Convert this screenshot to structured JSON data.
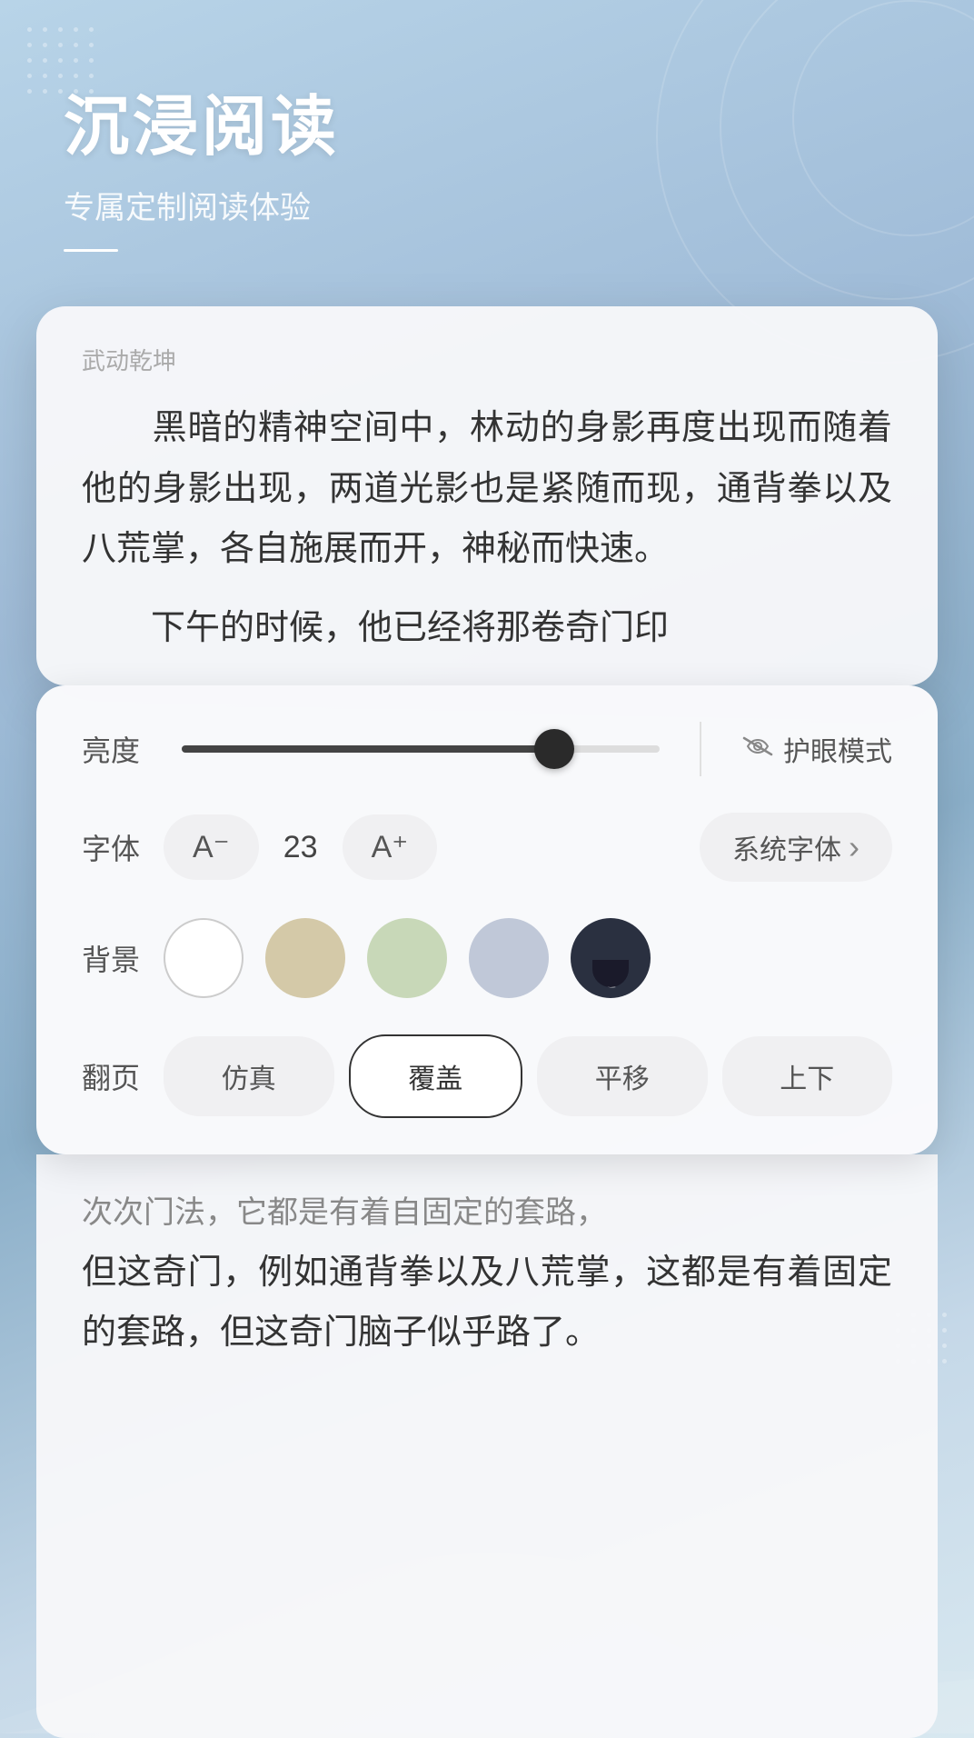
{
  "header": {
    "title": "沉浸阅读",
    "subtitle": "专属定制阅读体验"
  },
  "reading_card": {
    "book_title": "武动乾坤",
    "paragraphs": [
      "　　黑暗的精神空间中，林动的身影再度出现而随着他的身影出现，两道光影也是紧随而现，通背拳以及八荒掌，各自施展而开，神秘而快速。",
      "　　下午的时候，他已经将那卷奇门印"
    ]
  },
  "settings": {
    "brightness_label": "亮度",
    "brightness_value": 78,
    "eye_mode_label": "护眼模式",
    "font_label": "字体",
    "font_decrease_label": "A⁻",
    "font_size_value": "23",
    "font_increase_label": "A⁺",
    "font_family_label": "系统字体",
    "bg_label": "背景",
    "bg_options": [
      {
        "id": "white",
        "color": "#ffffff",
        "active": false
      },
      {
        "id": "beige",
        "color": "#d4c9a8",
        "active": false
      },
      {
        "id": "green",
        "color": "#c8d8b8",
        "active": false
      },
      {
        "id": "blue_gray",
        "color": "#c0c8d8",
        "active": false
      },
      {
        "id": "dark",
        "color": "#2a3040",
        "active": false
      }
    ],
    "pageturn_label": "翻页",
    "pageturn_options": [
      {
        "id": "simulate",
        "label": "仿真",
        "active": false
      },
      {
        "id": "cover",
        "label": "覆盖",
        "active": true
      },
      {
        "id": "slide",
        "label": "平移",
        "active": false
      },
      {
        "id": "updown",
        "label": "上下",
        "active": false
      }
    ]
  },
  "bottom_reading": {
    "blurred_text": "次次门法，它都是有着自固定的套路，",
    "paragraphs": [
      "但这奇门，例如通背拳以及八荒掌，这都是有着固定的套路，但这奇门脑子似乎路了。"
    ]
  },
  "icons": {
    "eye_icon": "⌒",
    "chevron_right": "›",
    "moon_icon": "🌙"
  }
}
